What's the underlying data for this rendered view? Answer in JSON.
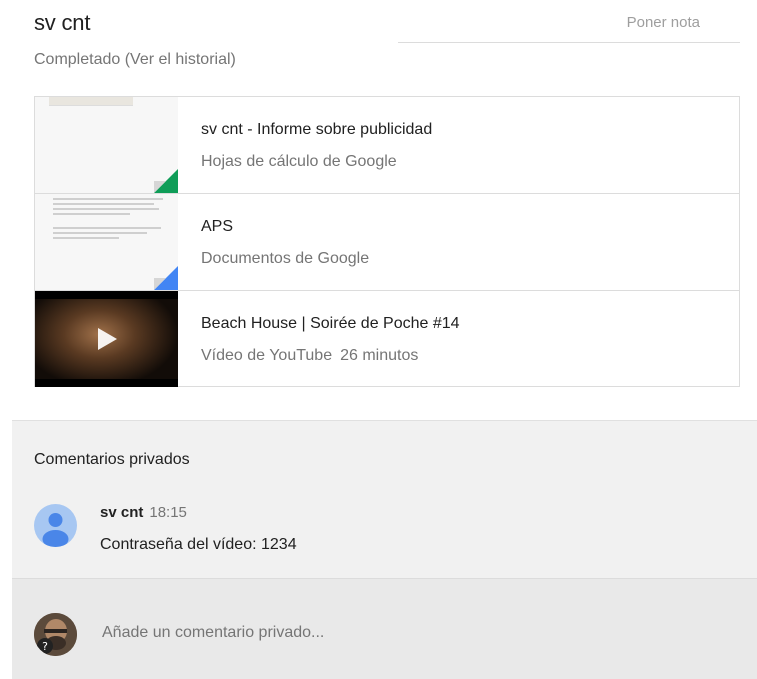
{
  "assignment": {
    "title": "sv cnt",
    "status": "Completado (Ver el historial)",
    "grade_placeholder": "Poner nota"
  },
  "attachments": [
    {
      "title": "sv cnt - Informe sobre publicidad",
      "type": "Hojas de cálculo de Google",
      "icon": "google-sheets-icon",
      "accent": "#0f9d58"
    },
    {
      "title": "APS",
      "type": "Documentos de Google",
      "icon": "google-docs-icon",
      "accent": "#4285f4"
    },
    {
      "title": "Beach House | Soirée de Poche #14",
      "type": "Vídeo de YouTube",
      "duration": "26 minutos",
      "icon": "play-icon"
    }
  ],
  "private_comments": {
    "title": "Comentarios privados",
    "items": [
      {
        "author": "sv cnt",
        "time": "18:15",
        "text": "Contraseña del vídeo: 1234"
      }
    ],
    "add_placeholder": "Añade un comentario privado..."
  }
}
